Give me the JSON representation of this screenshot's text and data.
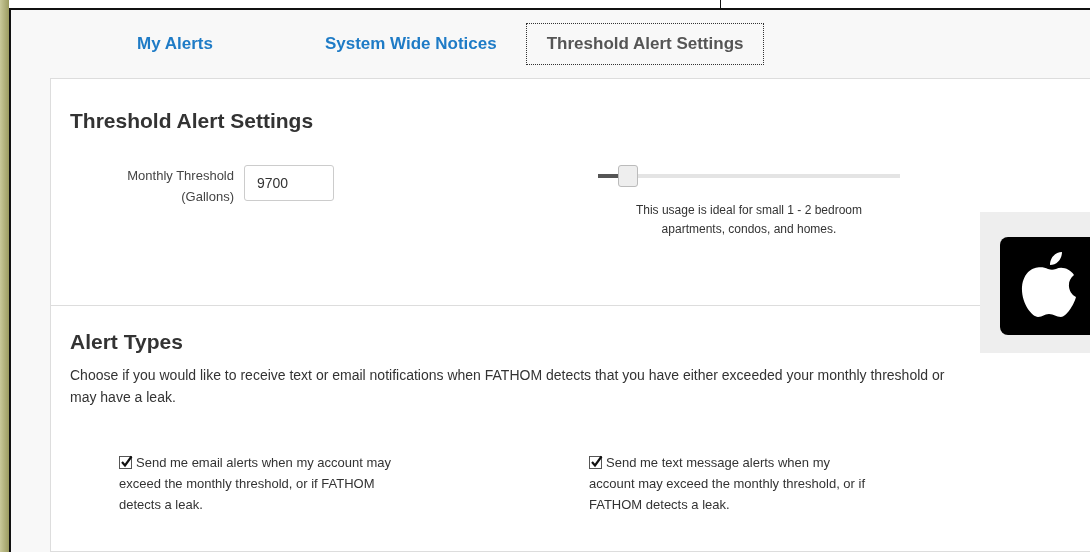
{
  "tabs": [
    {
      "label": "My Alerts",
      "selected": false
    },
    {
      "label": "System Wide Notices",
      "selected": false
    },
    {
      "label": "Threshold Alert Settings",
      "selected": true
    }
  ],
  "threshold_section": {
    "title": "Threshold Alert Settings",
    "field_label": "Monthly Threshold (Gallons)",
    "value": "9700",
    "slider": {
      "level": 0.1
    },
    "hint": "This usage is ideal for small 1 - 2 bedroom apartments, condos, and homes."
  },
  "alert_types": {
    "title": "Alert Types",
    "description": "Choose if you would like to receive text or email notifications when FATHOM detects that you have either exceeded your monthly threshold or may have a leak.",
    "options": [
      {
        "label": "Send me email alerts when my account may exceed the monthly threshold, or if FATHOM detects a leak.",
        "checked": true
      },
      {
        "label": "Send me text message alerts when my account may exceed the monthly threshold, or if FATHOM detects a leak.",
        "checked": true
      }
    ]
  }
}
